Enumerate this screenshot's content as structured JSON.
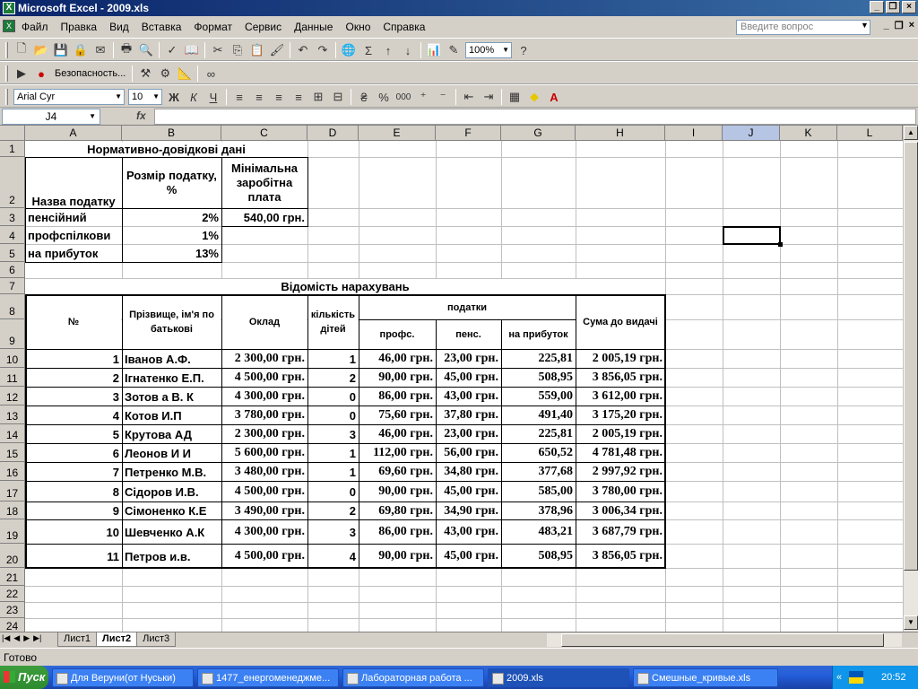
{
  "window": {
    "title": "Microsoft Excel - 2009.xls"
  },
  "menu": [
    "Файл",
    "Правка",
    "Вид",
    "Вставка",
    "Формат",
    "Сервис",
    "Данные",
    "Окно",
    "Справка"
  ],
  "ask_placeholder": "Введите вопрос",
  "toolbar": {
    "zoom": "100%",
    "security_label": "Безопасность...",
    "font_name": "Arial Cyr",
    "font_size": "10",
    "bold": "Ж",
    "italic": "К",
    "underline": "Ч",
    "percent": "%",
    "thousands": "000"
  },
  "formula_bar": {
    "name_box": "J4",
    "fx": "fx",
    "formula": ""
  },
  "columns": [
    "A",
    "B",
    "C",
    "D",
    "E",
    "F",
    "G",
    "H",
    "I",
    "J",
    "K",
    "L"
  ],
  "selected_column": "J",
  "rows": [
    "1",
    "2",
    "3",
    "4",
    "5",
    "6",
    "7",
    "8",
    "9",
    "10",
    "11",
    "12",
    "13",
    "14",
    "15",
    "16",
    "17",
    "18",
    "19",
    "20",
    "21",
    "22",
    "23",
    "24"
  ],
  "reference": {
    "title": "Нормативно-довідкові дані",
    "headers": [
      "Назва податку",
      "Розмір податку, %",
      "Мінімальна заробітна плата"
    ],
    "items": [
      {
        "name": "пенсійний",
        "rate": "2%",
        "min_wage": "540,00 грн."
      },
      {
        "name": "профспілкови",
        "rate": "1%",
        "min_wage": ""
      },
      {
        "name": "на прибуток",
        "rate": "13%",
        "min_wage": ""
      }
    ]
  },
  "payroll": {
    "title": "Відомість нарахувань",
    "headers": {
      "num": "№",
      "name": "Прізвище, ім'я по батькові",
      "salary": "Оклад",
      "children": "кількість дітей",
      "taxes": "податки",
      "union": "профс.",
      "pension": "пенс.",
      "income": "на прибуток",
      "total": "Сума до видачі"
    },
    "rows": [
      {
        "n": "1",
        "name": "Іванов А.Ф.",
        "salary": "2 300,00 грн.",
        "kids": "1",
        "union": "46,00 грн.",
        "pension": "23,00 грн.",
        "income": "225,81",
        "total": "2 005,19 грн."
      },
      {
        "n": "2",
        "name": "Ігнатенко Е.П.",
        "salary": "4 500,00 грн.",
        "kids": "2",
        "union": "90,00 грн.",
        "pension": "45,00 грн.",
        "income": "508,95",
        "total": "3 856,05 грн."
      },
      {
        "n": "3",
        "name": "Зотов а В. К",
        "salary": "4 300,00 грн.",
        "kids": "0",
        "union": "86,00 грн.",
        "pension": "43,00 грн.",
        "income": "559,00",
        "total": "3 612,00 грн."
      },
      {
        "n": "4",
        "name": "Котов И.П",
        "salary": "3 780,00 грн.",
        "kids": "0",
        "union": "75,60 грн.",
        "pension": "37,80 грн.",
        "income": "491,40",
        "total": "3 175,20 грн."
      },
      {
        "n": "5",
        "name": "Крутова АД",
        "salary": "2 300,00 грн.",
        "kids": "3",
        "union": "46,00 грн.",
        "pension": "23,00 грн.",
        "income": "225,81",
        "total": "2 005,19 грн."
      },
      {
        "n": "6",
        "name": "Леонов И И",
        "salary": "5 600,00 грн.",
        "kids": "1",
        "union": "112,00 грн.",
        "pension": "56,00 грн.",
        "income": "650,52",
        "total": "4 781,48 грн."
      },
      {
        "n": "7",
        "name": "Петренко М.В.",
        "salary": "3 480,00 грн.",
        "kids": "1",
        "union": "69,60 грн.",
        "pension": "34,80 грн.",
        "income": "377,68",
        "total": "2 997,92 грн."
      },
      {
        "n": "8",
        "name": "Сідоров И.В.",
        "salary": "4 500,00 грн.",
        "kids": "0",
        "union": "90,00 грн.",
        "pension": "45,00 грн.",
        "income": "585,00",
        "total": "3 780,00 грн."
      },
      {
        "n": "9",
        "name": "Сімоненко К.Е",
        "salary": "3 490,00 грн.",
        "kids": "2",
        "union": "69,80 грн.",
        "pension": "34,90 грн.",
        "income": "378,96",
        "total": "3 006,34 грн."
      },
      {
        "n": "10",
        "name": "Шевченко А.К",
        "salary": "4 300,00 грн.",
        "kids": "3",
        "union": "86,00 грн.",
        "pension": "43,00 грн.",
        "income": "483,21",
        "total": "3 687,79 грн."
      },
      {
        "n": "11",
        "name": "Петров и.в.",
        "salary": "4 500,00 грн.",
        "kids": "4",
        "union": "90,00 грн.",
        "pension": "45,00 грн.",
        "income": "508,95",
        "total": "3 856,05 грн."
      }
    ]
  },
  "sheets": [
    "Лист1",
    "Лист2",
    "Лист3"
  ],
  "active_sheet": "Лист2",
  "status": "Готово",
  "taskbar": {
    "start": "Пуск",
    "tasks": [
      "Для Веруни(от Нуськи)",
      "1477_енергоменеджме...",
      "Лабораторная работа ...",
      "2009.xls",
      "Смешные_кривые.xls"
    ],
    "active_task": "2009.xls",
    "clock": "20:52"
  },
  "colors": {
    "title_bar": "#0a246a",
    "selection": "#000000",
    "taskbar": "#245edb"
  }
}
